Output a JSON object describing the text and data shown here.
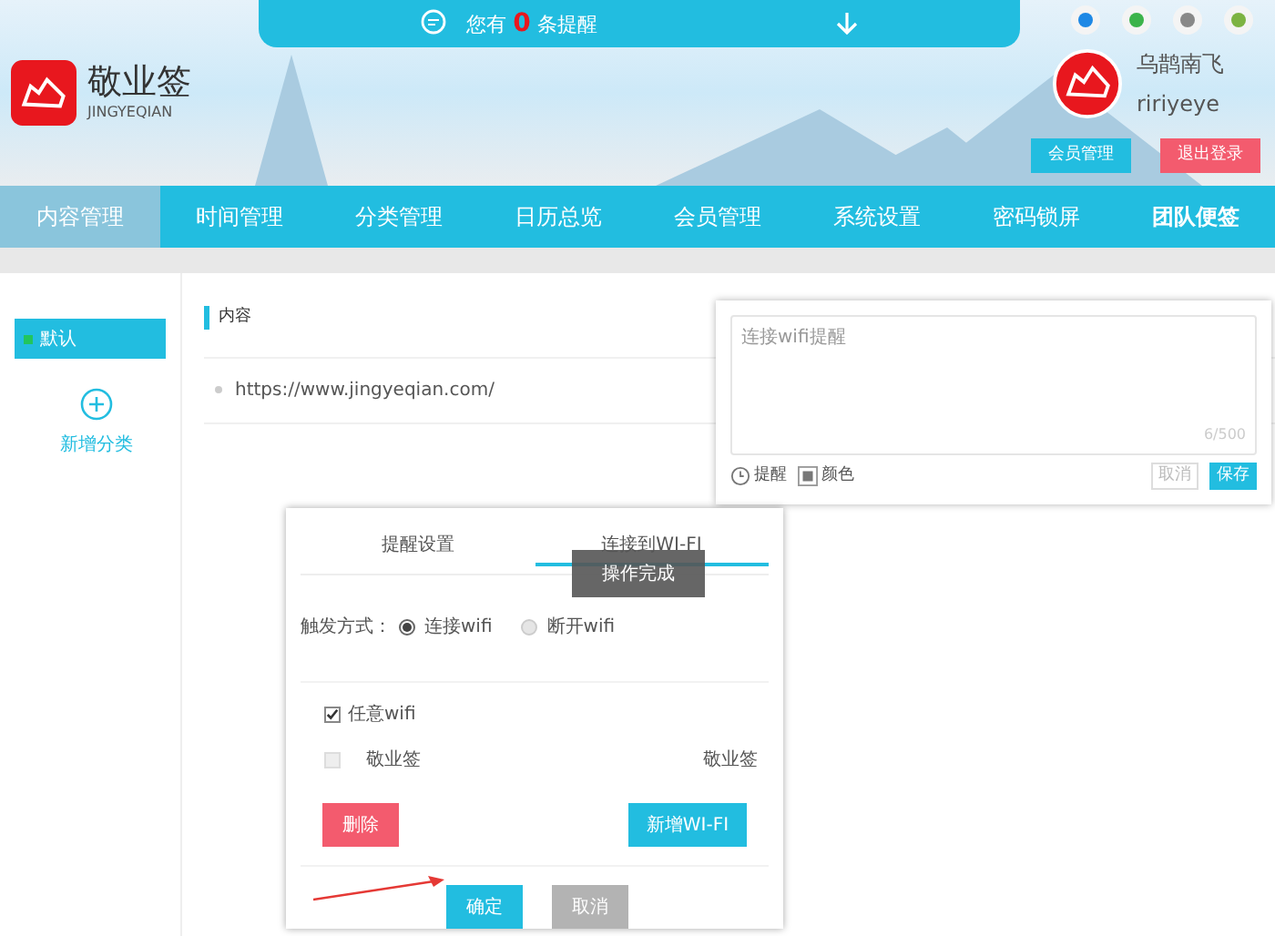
{
  "notification": {
    "prefix": "您有",
    "count": "0",
    "suffix": "条提醒"
  },
  "logo": {
    "name": "敬业签",
    "subtitle": "JINGYEQIAN"
  },
  "user": {
    "name": "乌鹊南飞",
    "account": "ririyeye",
    "buttons": [
      {
        "label": "会员管理",
        "kind": "primary"
      },
      {
        "label": "退出登录",
        "kind": "danger"
      }
    ]
  },
  "nav": [
    {
      "label": "内容管理",
      "selected": true,
      "emphasized": false
    },
    {
      "label": "时间管理",
      "selected": false,
      "emphasized": false
    },
    {
      "label": "分类管理",
      "selected": false,
      "emphasized": false
    },
    {
      "label": "日历总览",
      "selected": false,
      "emphasized": false
    },
    {
      "label": "会员管理",
      "selected": false,
      "emphasized": false
    },
    {
      "label": "系统设置",
      "selected": false,
      "emphasized": false
    },
    {
      "label": "密码锁屏",
      "selected": false,
      "emphasized": false
    },
    {
      "label": "团队便签",
      "selected": false,
      "emphasized": true
    }
  ],
  "sidebar": {
    "categories": [
      {
        "label": "默认",
        "selected": true
      }
    ],
    "add_label": "新增分类"
  },
  "content": {
    "heading": "内容",
    "items": [
      "https://www.jingyeqian.com/"
    ]
  },
  "editor": {
    "text": "连接wifi提醒",
    "counter": "6/500",
    "tools": [
      "提醒",
      "颜色"
    ],
    "buttons": [
      {
        "label": "取消",
        "kind": "secondary"
      },
      {
        "label": "保存",
        "kind": "primary"
      }
    ]
  },
  "dialog": {
    "tabs": [
      {
        "label": "提醒设置",
        "selected": false
      },
      {
        "label": "连接到WI-FI",
        "selected": true
      }
    ],
    "trigger": {
      "label": "触发方式：",
      "options": [
        {
          "label": "连接wifi",
          "selected": true
        },
        {
          "label": "断开wifi",
          "selected": false
        }
      ]
    },
    "wifi_list": [
      {
        "label": "任意wifi",
        "checked": true
      },
      {
        "label": "敬业签",
        "checked": false,
        "detail": "敬业签"
      }
    ],
    "delete_button": "删除",
    "add_button": "新增WI-FI",
    "buttons": [
      {
        "label": "确定",
        "kind": "primary"
      },
      {
        "label": "取消",
        "kind": "secondary"
      }
    ]
  },
  "toast": "操作完成"
}
